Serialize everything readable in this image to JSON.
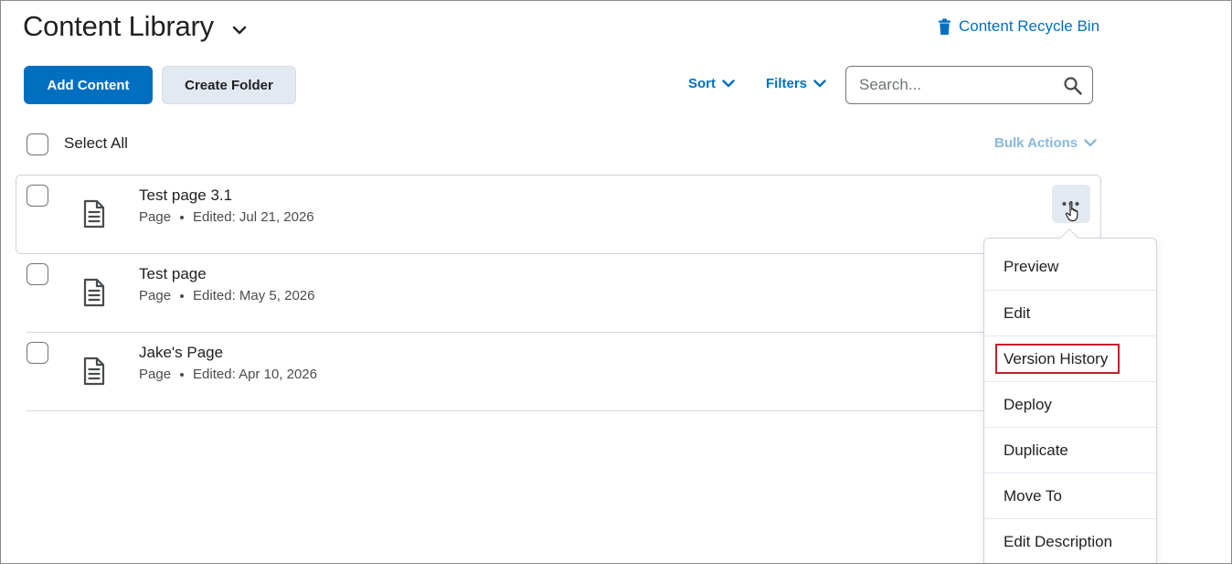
{
  "header": {
    "title": "Content Library",
    "recycle_bin": "Content Recycle Bin"
  },
  "toolbar": {
    "add_content": "Add Content",
    "create_folder": "Create Folder",
    "sort": "Sort",
    "filters": "Filters",
    "search_placeholder": "Search..."
  },
  "list_header": {
    "select_all": "Select All",
    "bulk_actions": "Bulk Actions"
  },
  "items": [
    {
      "title": "Test page 3.1",
      "type": "Page",
      "edited": "Edited: Jul 21, 2026"
    },
    {
      "title": "Test page",
      "type": "Page",
      "edited": "Edited: May 5, 2026"
    },
    {
      "title": "Jake's Page",
      "type": "Page",
      "edited": "Edited: Apr 10, 2026"
    }
  ],
  "context_menu": {
    "items": [
      "Preview",
      "Edit",
      "Version History",
      "Deploy",
      "Duplicate",
      "Move To",
      "Edit Description"
    ],
    "highlighted": "Version History"
  },
  "colors": {
    "accent": "#006fbf",
    "secondary_button": "#e3e9f1",
    "highlight_outline": "#c0202a",
    "disabled_link": "#8ab9dc"
  }
}
